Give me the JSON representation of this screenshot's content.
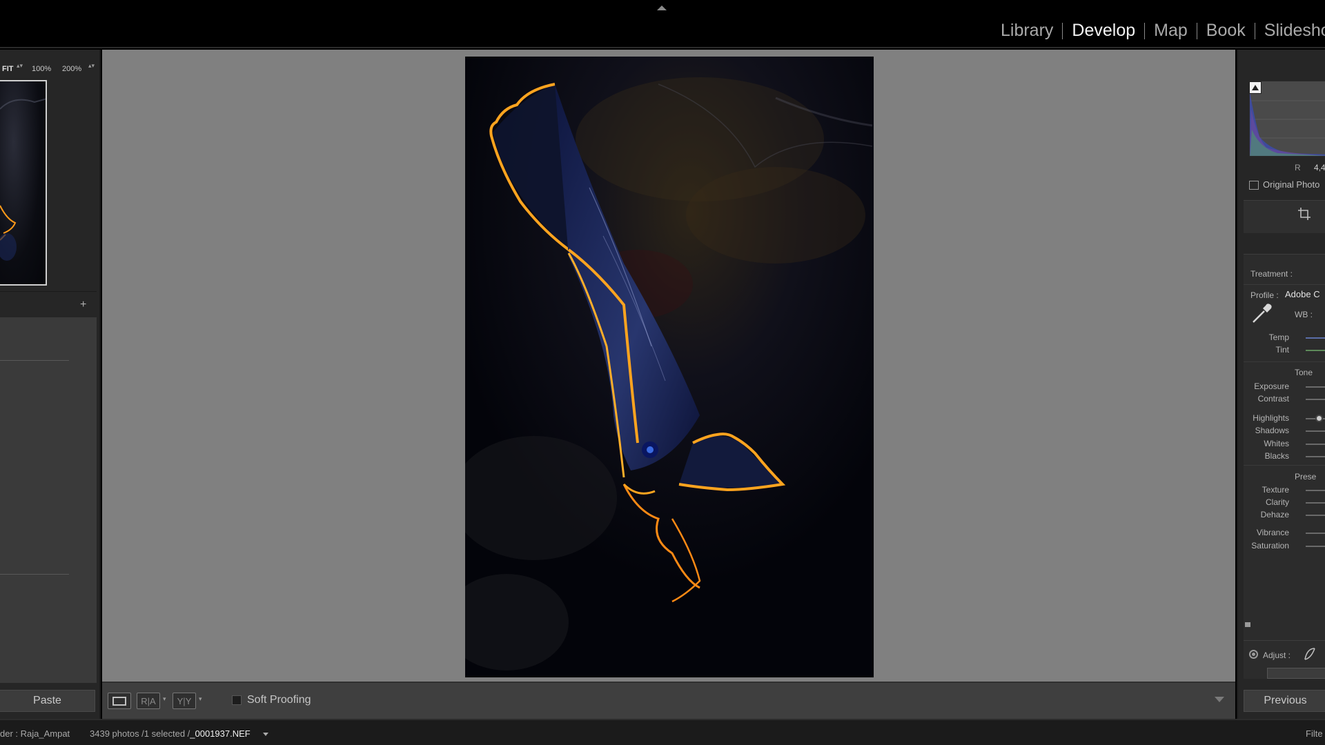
{
  "modules": {
    "items": [
      "Library",
      "Develop",
      "Map",
      "Book",
      "Slideshow"
    ],
    "active": "Develop"
  },
  "navigator": {
    "zoom_fit": "FIT",
    "zoom_100": "100%",
    "zoom_200": "200%",
    "stepper": "▴▾"
  },
  "left_panel": {
    "plus": "+",
    "paste_label": "Paste"
  },
  "toolbar": {
    "view_ra": "R|A",
    "view_yy": "Y|Y",
    "caret": "▾",
    "soft_proofing": "Soft Proofing"
  },
  "right_panel": {
    "histogram": {
      "channel": "R",
      "value": "4,4"
    },
    "original_photo": "Original Photo",
    "treatment_label": "Treatment :",
    "profile_label": "Profile :",
    "profile_value": "Adobe C",
    "wb_label": "WB :",
    "temp": "Temp",
    "tint": "Tint",
    "tone_header": "Tone",
    "exposure": "Exposure",
    "contrast": "Contrast",
    "highlights": "Highlights",
    "shadows": "Shadows",
    "whites": "Whites",
    "blacks": "Blacks",
    "presence_header": "Prese",
    "texture": "Texture",
    "clarity": "Clarity",
    "dehaze": "Dehaze",
    "vibrance": "Vibrance",
    "saturation": "Saturation",
    "adjust_label": "Adjust :",
    "previous_label": "Previous"
  },
  "status_bar": {
    "folder": "der : Raja_Ampat",
    "count": "3439 photos /1 selected /",
    "filename": "_0001937.NEF",
    "filter": "Filte"
  },
  "colors": {
    "fin_glow": "#ff9a1a",
    "fish_body": "#1b2a5e",
    "center_bg": "#808080"
  }
}
